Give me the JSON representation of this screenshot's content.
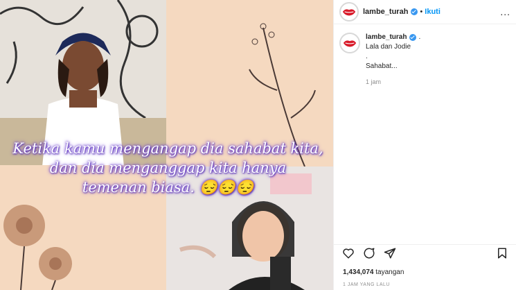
{
  "post": {
    "caption_overlay": [
      "Ketika kamu mengangap dia sahabat kita,",
      "dan dia menganggap kita hanya",
      "temenan biasa. 😔😔😔"
    ]
  },
  "header": {
    "username": "lambe_turah",
    "separator": "•",
    "follow_label": "Ikuti",
    "more_label": "..."
  },
  "comment": {
    "username": "lambe_turah",
    "suffix": ".",
    "lines": [
      "Lala dan Jodie",
      ".",
      "Sahabat..."
    ],
    "time": "1 jam"
  },
  "actions": {
    "icons": [
      "heart-icon",
      "comment-icon",
      "share-icon",
      "bookmark-icon"
    ]
  },
  "stats": {
    "views_count": "1,434,074",
    "views_label": "tayangan",
    "posted_ago": "1 JAM YANG LALU"
  },
  "colors": {
    "accent": "#0095f6",
    "verified": "#3897f0",
    "overlay_glow": "#6c3fd0"
  }
}
